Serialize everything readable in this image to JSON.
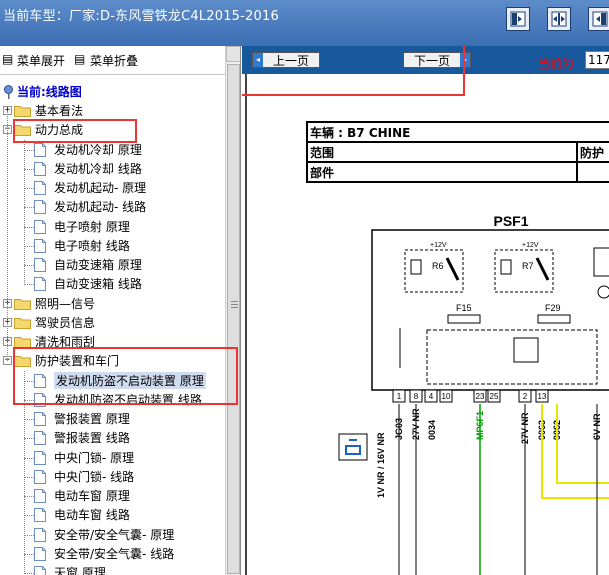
{
  "window": {
    "title": "当前车型：厂家:D-东风雪铁龙C4L2015-2016",
    "buttons": [
      "tile-left-icon",
      "tile-split-icon",
      "tile-right-icon"
    ]
  },
  "left_panel": {
    "menu": {
      "expand_label": "菜单展开",
      "collapse_label": "菜单折叠"
    },
    "current_label": "当前:线路图",
    "tree": [
      {
        "label": "基本看法",
        "type": "folder",
        "expanded": false
      },
      {
        "label": "动力总成",
        "type": "folder",
        "expanded": true
      },
      {
        "label": "发动机冷却 原理",
        "type": "doc"
      },
      {
        "label": "发动机冷却 线路",
        "type": "doc"
      },
      {
        "label": "发动机起动- 原理",
        "type": "doc"
      },
      {
        "label": "发动机起动- 线路",
        "type": "doc"
      },
      {
        "label": "电子喷射 原理",
        "type": "doc"
      },
      {
        "label": "电子喷射 线路",
        "type": "doc"
      },
      {
        "label": "自动变速箱 原理",
        "type": "doc"
      },
      {
        "label": "自动变速箱 线路",
        "type": "doc"
      },
      {
        "label": "照明—信号",
        "type": "folder",
        "expanded": false
      },
      {
        "label": "驾驶员信息",
        "type": "folder",
        "expanded": false
      },
      {
        "label": "清洗和雨刮",
        "type": "folder",
        "expanded": false
      },
      {
        "label": "防护装置和车门",
        "type": "folder",
        "expanded": true
      },
      {
        "label": "发动机防盗不启动装置 原理",
        "type": "doc",
        "selected": true
      },
      {
        "label": "发动机防盗不启动装置 线路",
        "type": "doc"
      },
      {
        "label": "警报装置 原理",
        "type": "doc"
      },
      {
        "label": "警报装置 线路",
        "type": "doc"
      },
      {
        "label": "中央门锁- 原理",
        "type": "doc"
      },
      {
        "label": "中央门锁- 线路",
        "type": "doc"
      },
      {
        "label": "电动车窗 原理",
        "type": "doc"
      },
      {
        "label": "电动车窗 线路",
        "type": "doc"
      },
      {
        "label": "安全带/安全气囊- 原理",
        "type": "doc"
      },
      {
        "label": "安全带/安全气囊- 线路",
        "type": "doc"
      },
      {
        "label": "天窗 原理",
        "type": "doc"
      }
    ]
  },
  "right_panel": {
    "nav": {
      "prev_label": "上一页",
      "next_label": "下一页",
      "current_page_label": "当前为",
      "current_page_value": "117"
    },
    "doc_table": {
      "vehicle_label": "车辆  : B7 CHINE",
      "range_label": "范围",
      "protect_label": "防护",
      "part_label": "部件"
    },
    "circuit": {
      "module_name": "PSF1",
      "relay1": "R6",
      "relay2": "R7",
      "supply1": "+12V",
      "supply2": "+12V",
      "fuse1": "F15",
      "fuse2": "F29",
      "pin_numbers": [
        "1",
        "8",
        "4",
        "10",
        "23",
        "25",
        "2",
        "13"
      ],
      "wire_labels": [
        "1V NR / 16V NR",
        "JG03",
        "27V NR",
        "0034",
        "MP6F1",
        "27V NR",
        "9063",
        "9062",
        "6V NR"
      ]
    }
  },
  "colors": {
    "titlebar": "#4a7cc0",
    "navbar": "#17599c",
    "highlight": "#ee3333",
    "tree_text": "#000000",
    "current_text": "#0000cc"
  }
}
